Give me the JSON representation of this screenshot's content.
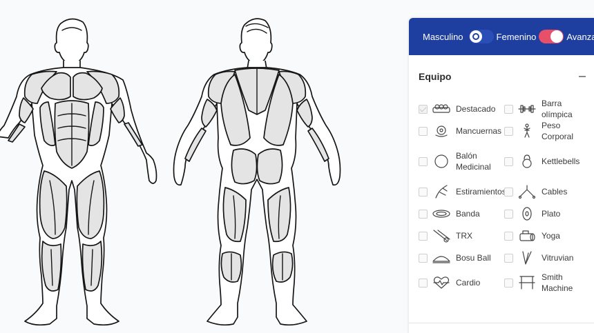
{
  "header": {
    "gender_male_label": "Masculino",
    "gender_female_label": "Femenino",
    "advanced_label": "Avanzado"
  },
  "equipment": {
    "title": "Equipo",
    "items": [
      {
        "label": "Destacado",
        "icon": "featured-icon",
        "checked": true
      },
      {
        "label": "Barra olímpica",
        "icon": "barbell-icon",
        "checked": false
      },
      {
        "label": "Mancuernas",
        "icon": "dumbbell-icon",
        "checked": false
      },
      {
        "label": "Peso Corporal",
        "icon": "bodyweight-icon",
        "checked": false
      },
      {
        "label": "Balón Medicinal",
        "icon": "medicine-ball-icon",
        "checked": false
      },
      {
        "label": "Kettlebells",
        "icon": "kettlebell-icon",
        "checked": false
      },
      {
        "label": "Estiramientos",
        "icon": "stretch-icon",
        "checked": false
      },
      {
        "label": "Cables",
        "icon": "cables-icon",
        "checked": false
      },
      {
        "label": "Banda",
        "icon": "band-icon",
        "checked": false
      },
      {
        "label": "Plato",
        "icon": "plate-icon",
        "checked": false
      },
      {
        "label": "TRX",
        "icon": "trx-icon",
        "checked": false
      },
      {
        "label": "Yoga",
        "icon": "yoga-icon",
        "checked": false
      },
      {
        "label": "Bosu Ball",
        "icon": "bosu-ball-icon",
        "checked": false
      },
      {
        "label": "Vitruvian",
        "icon": "vitruvian-icon",
        "checked": false
      },
      {
        "label": "Cardio",
        "icon": "cardio-icon",
        "checked": false
      },
      {
        "label": "Smith Machine",
        "icon": "smith-machine-icon",
        "checked": false
      }
    ]
  },
  "colors": {
    "header_bg": "#1e3fa0",
    "toggle_on": "#e8506a",
    "muscle_fill": "#e4e4e4"
  }
}
